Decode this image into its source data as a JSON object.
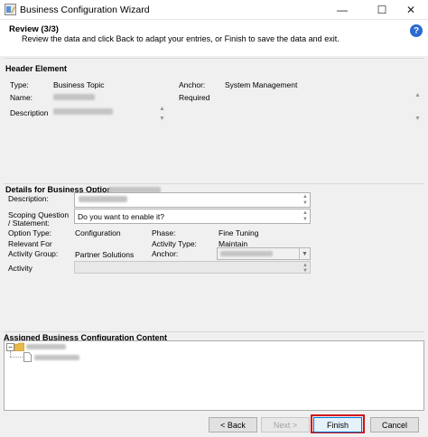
{
  "window": {
    "title": "Business Configuration Wizard",
    "minimize_glyph": "—",
    "maximize_glyph": "☐",
    "close_glyph": "✕"
  },
  "step": {
    "title": "Review (3/3)",
    "description": "Review the data and click Back to adapt your entries, or Finish to save the data and exit.",
    "help_glyph": "?"
  },
  "header_element": {
    "section_title": "Header Element",
    "type_label": "Type:",
    "type_value": "Business Topic",
    "name_label": "Name:",
    "description_label": "Description",
    "anchor_label": "Anchor:",
    "anchor_value": "System Management",
    "required_label": "Required"
  },
  "details": {
    "section_title": "Details for Business Option",
    "description_label": "Description:",
    "scoping_label_1": "Scoping Question",
    "scoping_label_2": "/ Statement:",
    "scoping_value": "Do you want to enable it?",
    "option_type_label": "Option Type:",
    "option_type_value": "Configuration",
    "relevant_for_label": "Relevant For",
    "activity_group_label": "Activity Group:",
    "activity_group_value": "Partner Solutions",
    "phase_label": "Phase:",
    "phase_value": "Fine Tuning",
    "activity_type_label": "Activity Type:",
    "activity_type_value": "Maintain",
    "anchor_label": "Anchor:",
    "activity_label": "Activity"
  },
  "assigned": {
    "section_title": "Assigned Business Configuration Content",
    "expand_glyph": "−"
  },
  "buttons": {
    "back": "< Back",
    "next": "Next >",
    "finish": "Finish",
    "cancel": "Cancel"
  },
  "colors": {
    "accent_help": "#2a6bd1",
    "highlight_outline": "#d0111b",
    "folder": "#e8b84a"
  }
}
